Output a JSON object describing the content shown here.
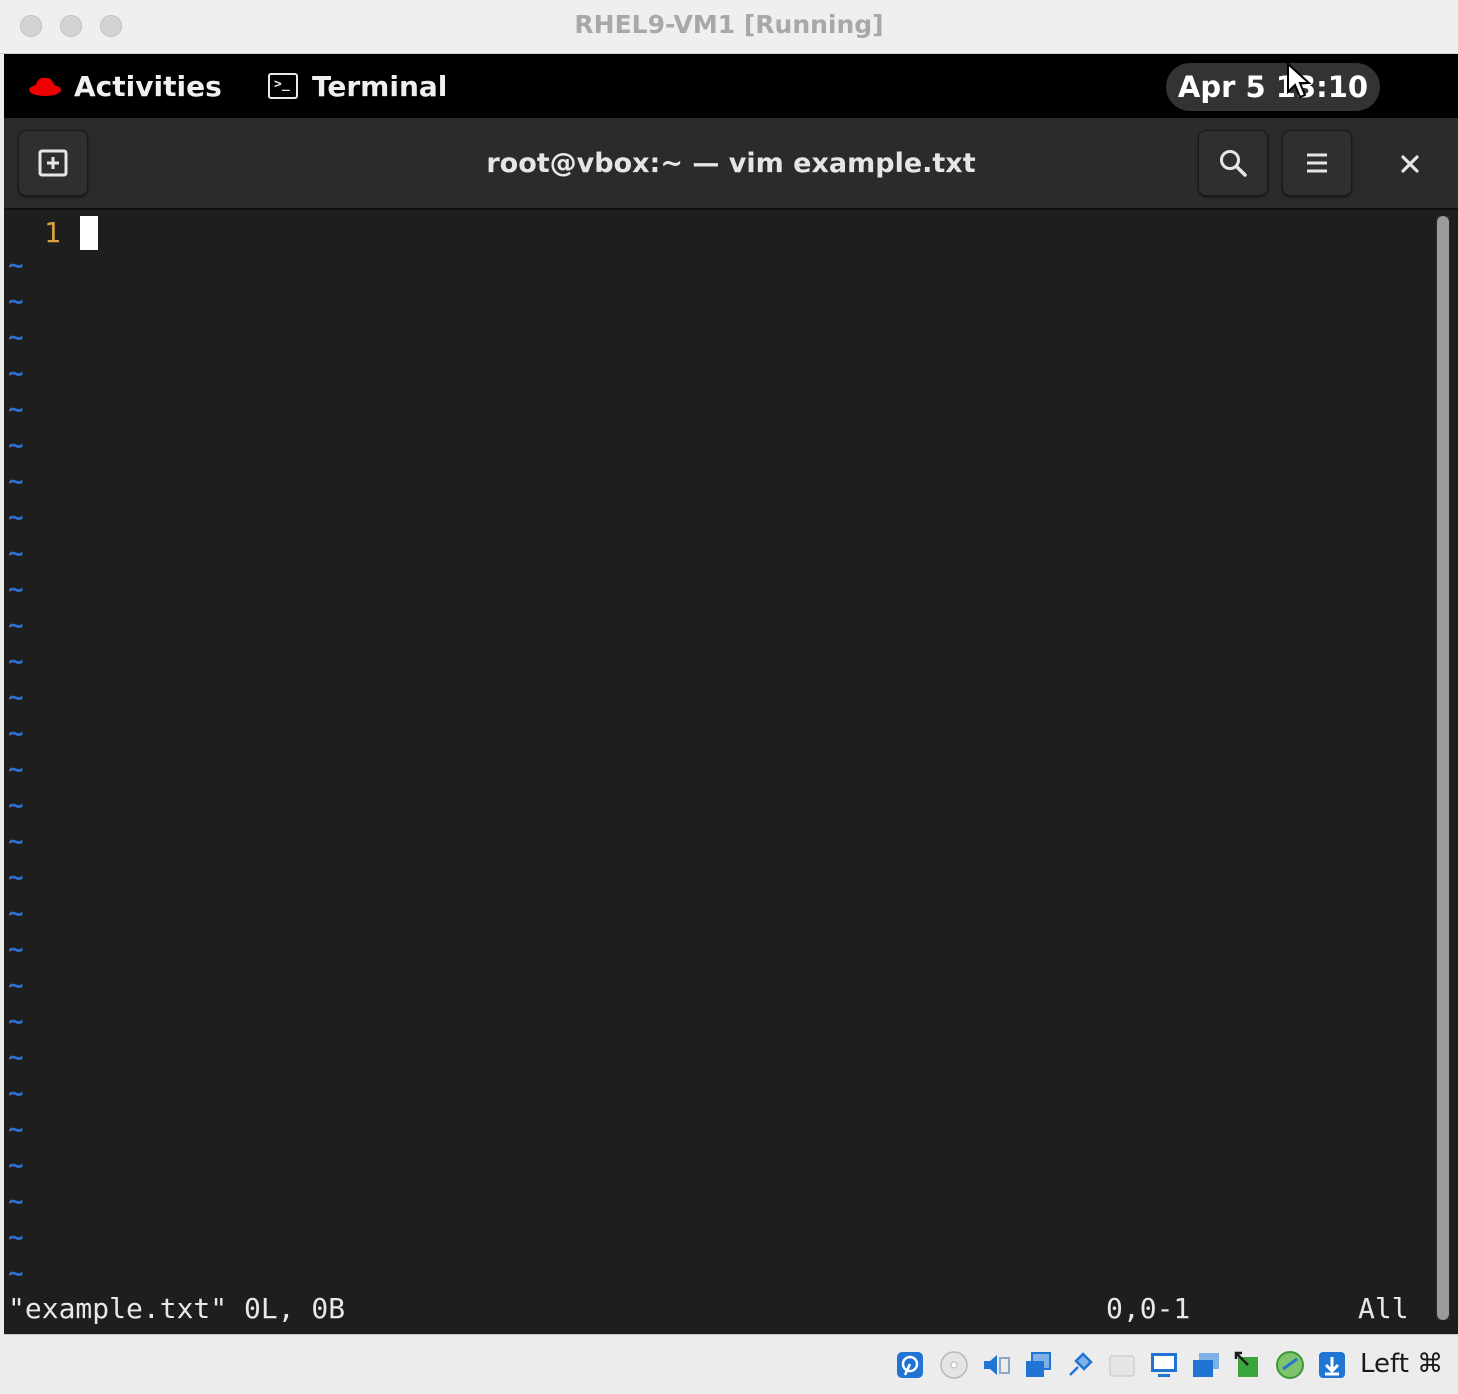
{
  "window": {
    "title": "RHEL9-VM1 [Running]"
  },
  "gnome_bar": {
    "activities_label": "Activities",
    "app_label": "Terminal",
    "clock": "Apr 5 13:10"
  },
  "terminal": {
    "title": "root@vbox:~ — vim example.txt",
    "line_number": "1",
    "tilde_char": "~",
    "tilde_count": 29,
    "status_file": "\"example.txt\" 0L, 0B",
    "status_position": "0,0-1",
    "status_scroll": "All"
  },
  "vbox_statusbar": {
    "icons": [
      "hard-disk-icon",
      "optical-drive-icon",
      "audio-icon",
      "network-icon",
      "usb-icon",
      "shared-folders-icon",
      "display-icon",
      "recording-icon",
      "mouse-integration-icon",
      "cpu-icon",
      "download-icon"
    ],
    "host_key": "Left ⌘"
  },
  "colors": {
    "accent_red": "#ee0000",
    "vim_line_number": "#d7a23a",
    "vim_tilde": "#2f6fd1",
    "vbox_blue": "#1f74d4"
  }
}
